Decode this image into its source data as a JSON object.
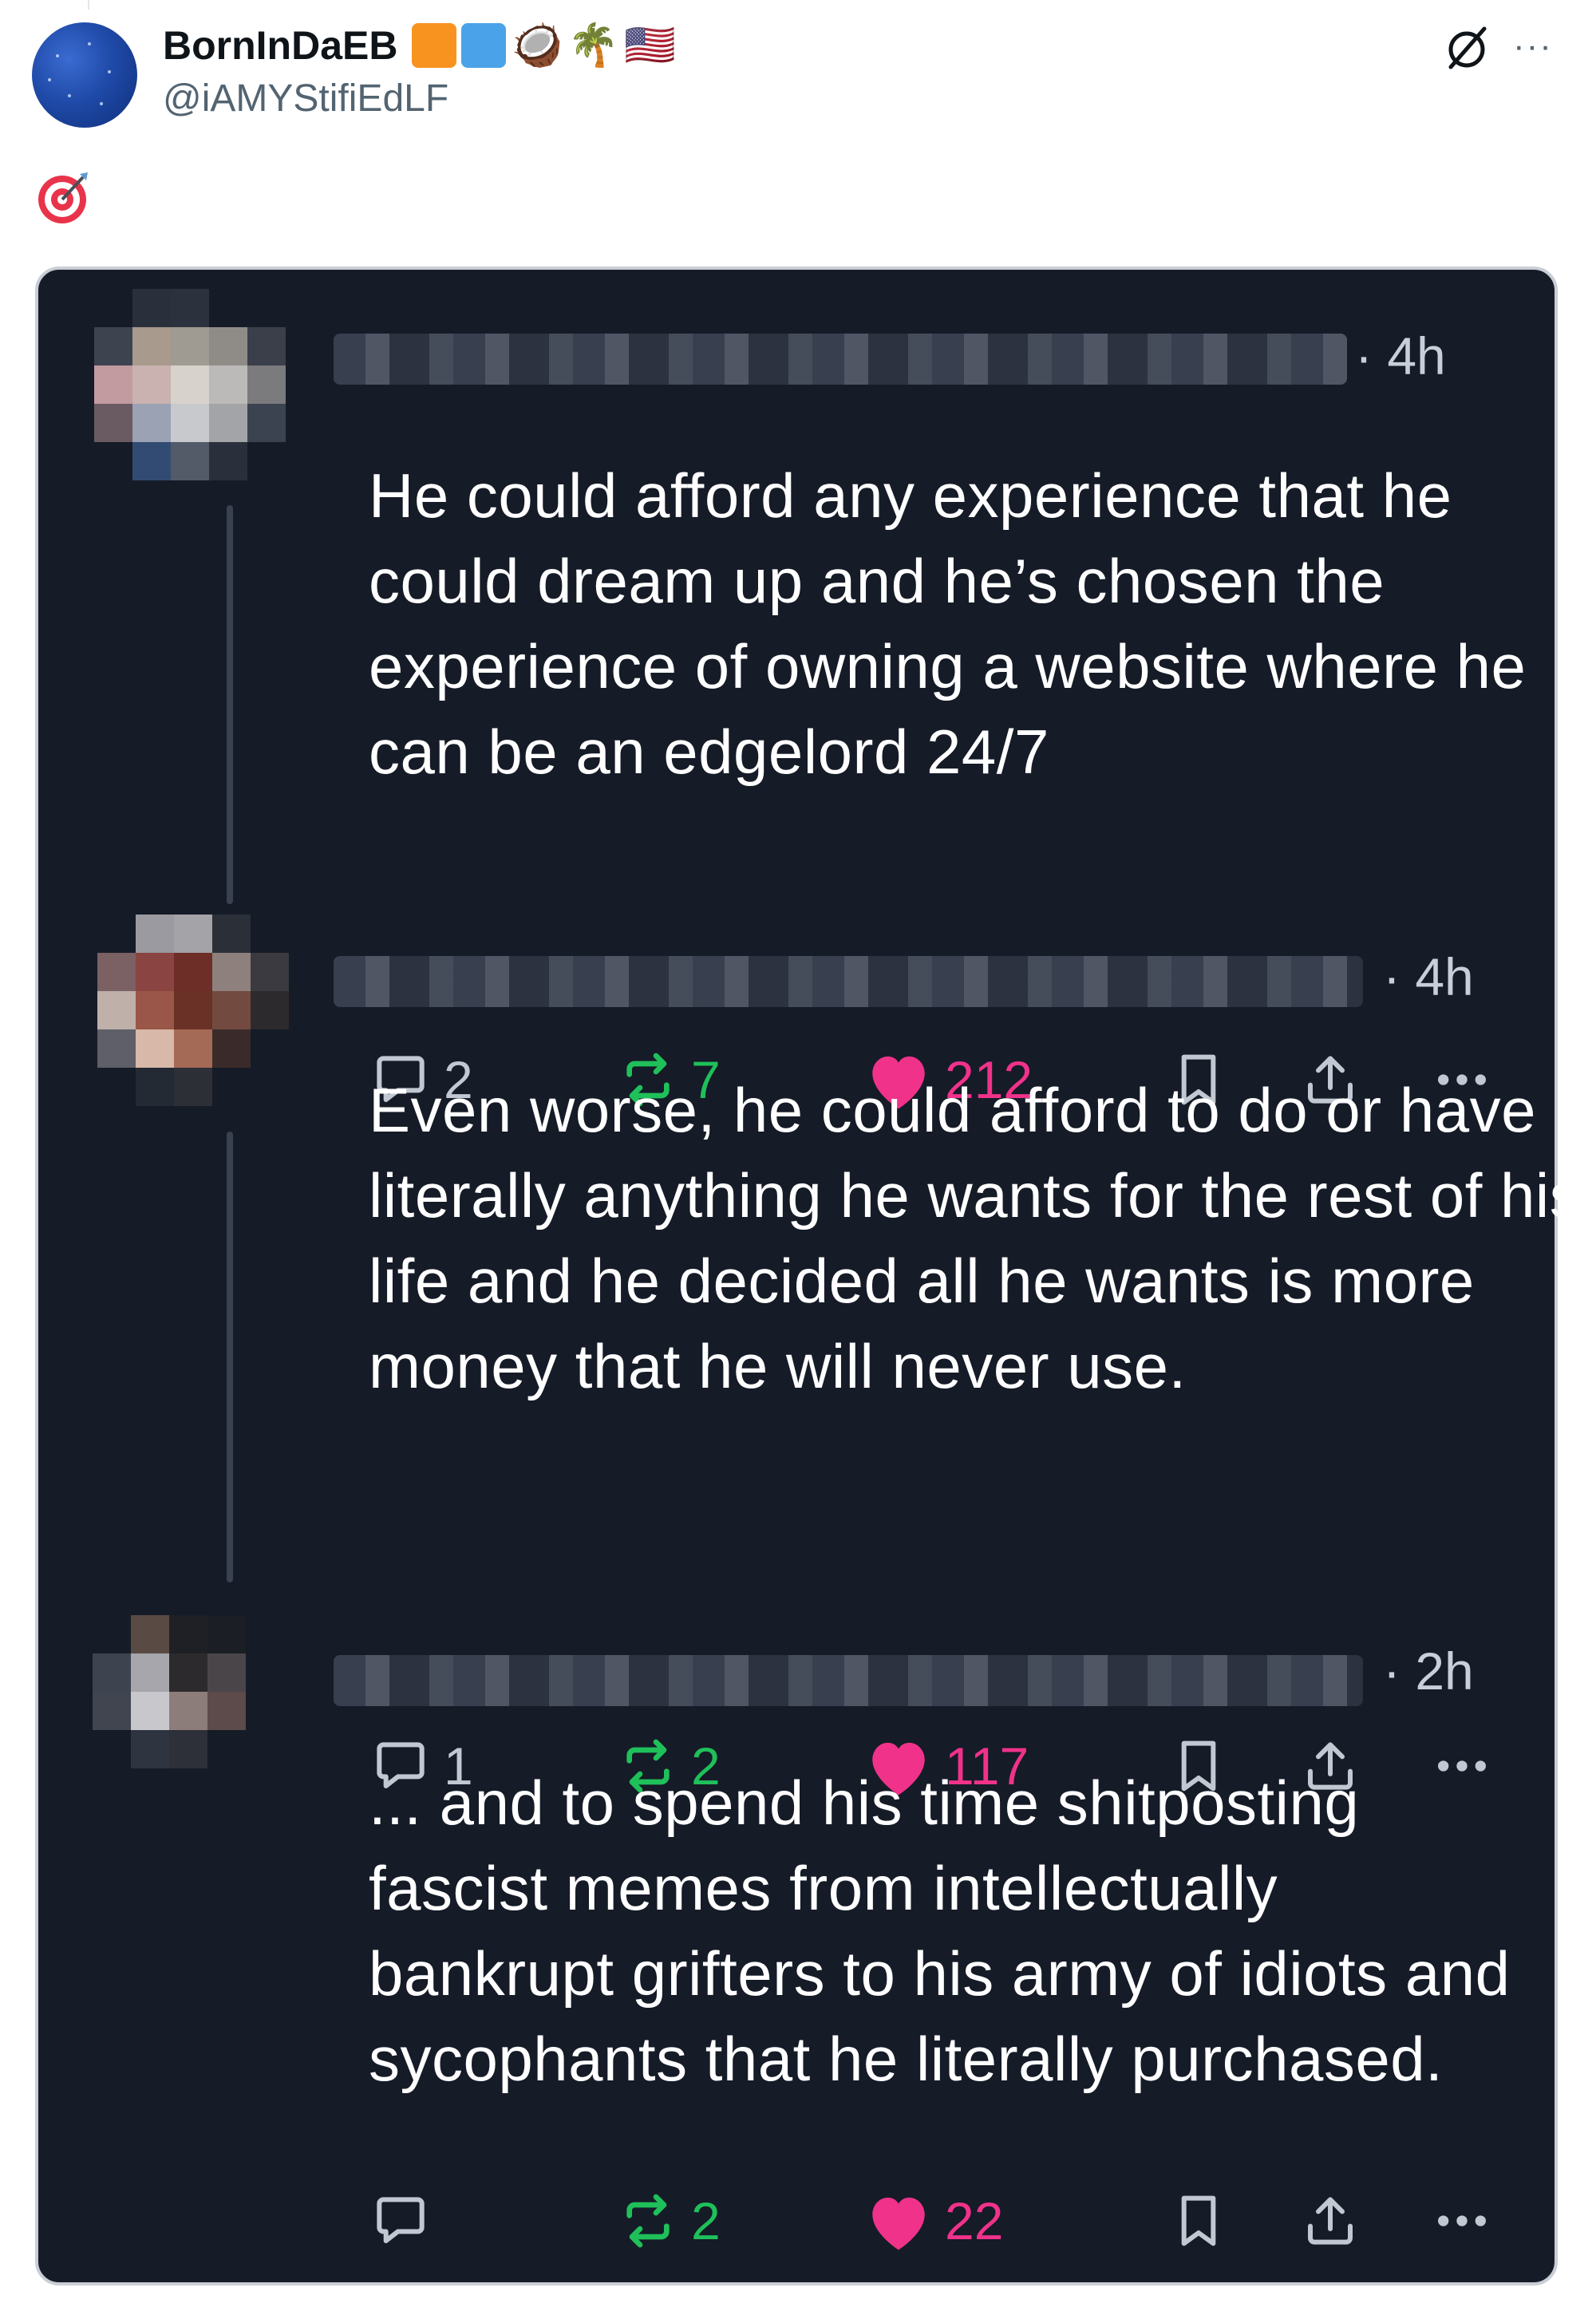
{
  "post": {
    "author_name": "BornInDaEB",
    "author_handle": "@iAMYStifiEdLF",
    "badges": [
      {
        "type": "square",
        "color": "#f7931e"
      },
      {
        "type": "square",
        "color": "#4aa3e8"
      },
      {
        "type": "emoji",
        "value": "🥥"
      },
      {
        "type": "emoji",
        "value": "🌴"
      },
      {
        "type": "emoji",
        "value": "🇺🇸"
      }
    ],
    "body_emoji": "🎯",
    "icons": {
      "grok": "grok-icon",
      "more": "more-icon"
    }
  },
  "replies": [
    {
      "time": "· 4h",
      "text": "He could afford any experience that he could dream up and he’s chosen the experience of owning a website where he can be an edgelord 24/7",
      "replies": "2",
      "reposts": "7",
      "likes": "212"
    },
    {
      "time": "· 4h",
      "text": "Even worse, he could afford to do or have literally anything he wants for the rest of his life and he decided all he wants is more money that he will never use.",
      "replies": "1",
      "reposts": "2",
      "likes": "117"
    },
    {
      "time": "· 2h",
      "text": "... and to spend his time shitposting fascist memes from intellectually bankrupt grifters to his army of idiots and sycophants that he literally purchased.",
      "replies": "",
      "reposts": "2",
      "likes": "22"
    }
  ],
  "colors": {
    "card_bg": "#151b27",
    "like": "#f0328a",
    "repost": "#1fc05a",
    "muted": "#c2c8d2"
  }
}
